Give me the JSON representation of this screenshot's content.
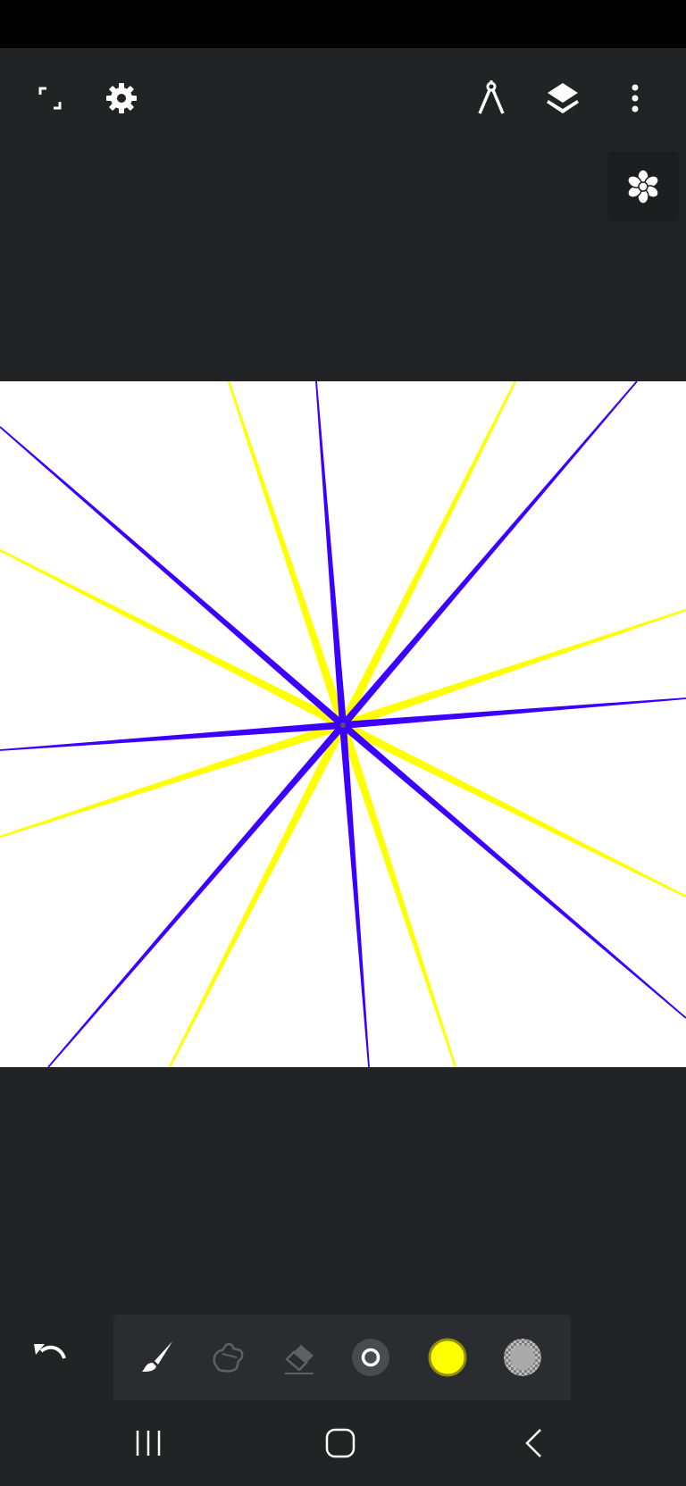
{
  "app": {
    "name": "Drawing canvas"
  },
  "toolbar": {
    "left": [
      {
        "name": "fullscreen-icon"
      },
      {
        "name": "gear-icon"
      }
    ],
    "right": [
      {
        "name": "compass-icon"
      },
      {
        "name": "layers-icon"
      },
      {
        "name": "more-vertical-icon"
      }
    ]
  },
  "symmetry": {
    "icon": "flower-symmetry-icon",
    "active": true
  },
  "canvas": {
    "background": "#ffffff",
    "stroke_colors": {
      "blue": "#3b00ff",
      "yellow": "#ffff00"
    }
  },
  "palette": {
    "tools": [
      {
        "name": "brush-icon",
        "selected": true
      },
      {
        "name": "smudge-icon",
        "selected": false
      },
      {
        "name": "eraser-icon",
        "selected": false
      },
      {
        "name": "brush-size-icon"
      },
      {
        "name": "color-swatch",
        "color": "#ffff00"
      },
      {
        "name": "opacity-swatch"
      }
    ]
  },
  "nav": [
    {
      "name": "recent-apps-icon"
    },
    {
      "name": "home-icon"
    },
    {
      "name": "back-icon"
    }
  ]
}
